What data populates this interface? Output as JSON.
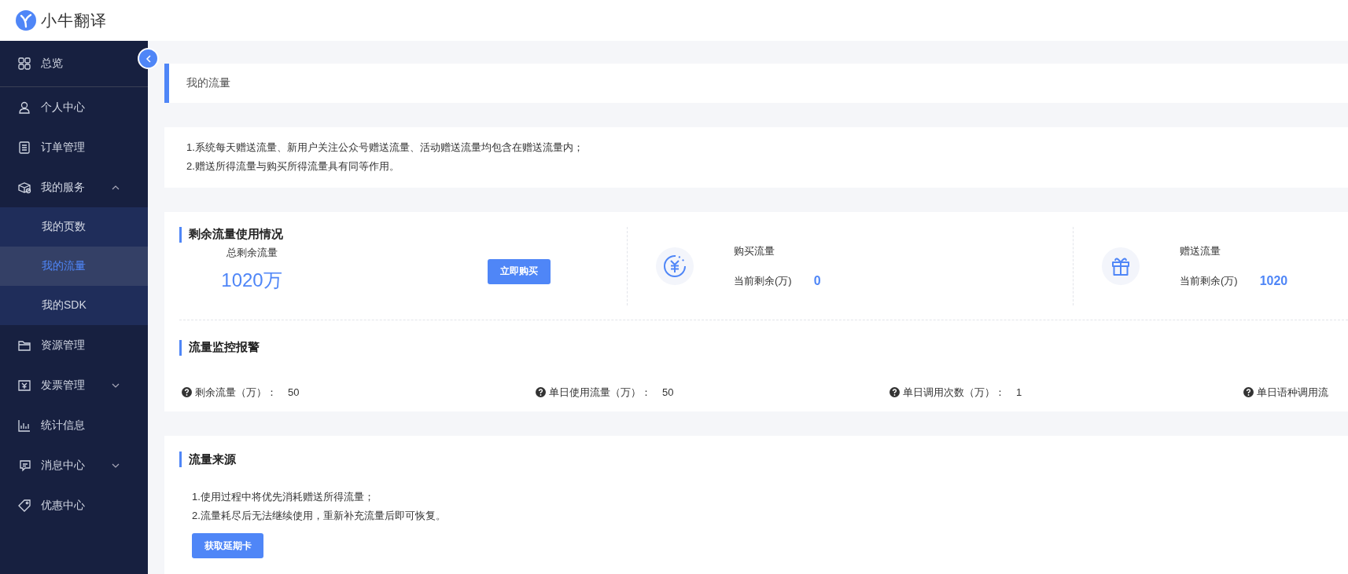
{
  "header": {
    "logo_text": "小牛翻译"
  },
  "sidebar": {
    "items": [
      {
        "label": "总览",
        "kind": "item",
        "selected": false
      },
      {
        "label": "个人中心",
        "kind": "item",
        "selected": false
      },
      {
        "label": "订单管理",
        "kind": "item",
        "selected": false
      },
      {
        "label": "我的服务",
        "kind": "group",
        "selected": false,
        "expanded": true,
        "children": [
          {
            "label": "我的页数",
            "selected": false
          },
          {
            "label": "我的流量",
            "selected": true
          },
          {
            "label": "我的SDK",
            "selected": false
          }
        ]
      },
      {
        "label": "资源管理",
        "kind": "item",
        "selected": false
      },
      {
        "label": "发票管理",
        "kind": "group",
        "selected": false,
        "expanded": false
      },
      {
        "label": "统计信息",
        "kind": "item",
        "selected": false
      },
      {
        "label": "消息中心",
        "kind": "group",
        "selected": false,
        "expanded": false
      },
      {
        "label": "优惠中心",
        "kind": "item",
        "selected": false
      }
    ]
  },
  "page_title": "我的流量",
  "notes": [
    "1.系统每天赠送流量、新用户关注公众号赠送流量、活动赠送流量均包含在赠送流量内；",
    "2.赠送所得流量与购买所得流量具有同等作用。"
  ],
  "usage": {
    "title": "剩余流量使用情况",
    "total_label": "总剩余流量",
    "total_value": "1020万",
    "buy_button": "立即购买",
    "sources": [
      {
        "name": "购买流量",
        "remaining_label": "当前剩余(万)",
        "value": "0"
      },
      {
        "name": "赠送流量",
        "remaining_label": "当前剩余(万)",
        "value": "1020"
      }
    ]
  },
  "alerts": {
    "title": "流量监控报警",
    "items": [
      {
        "label": "剩余流量（万）：",
        "value": "50"
      },
      {
        "label": "单日使用流量（万）：",
        "value": "50"
      },
      {
        "label": "单日调用次数（万）：",
        "value": "1"
      },
      {
        "label": "单日语种调用流"
      }
    ]
  },
  "source": {
    "title": "流量来源",
    "notes": [
      "1.使用过程中将优先消耗赠送所得流量；",
      "2.流量耗尽后无法继续使用，重新补充流量后即可恢复。"
    ],
    "button": "获取延期卡"
  }
}
